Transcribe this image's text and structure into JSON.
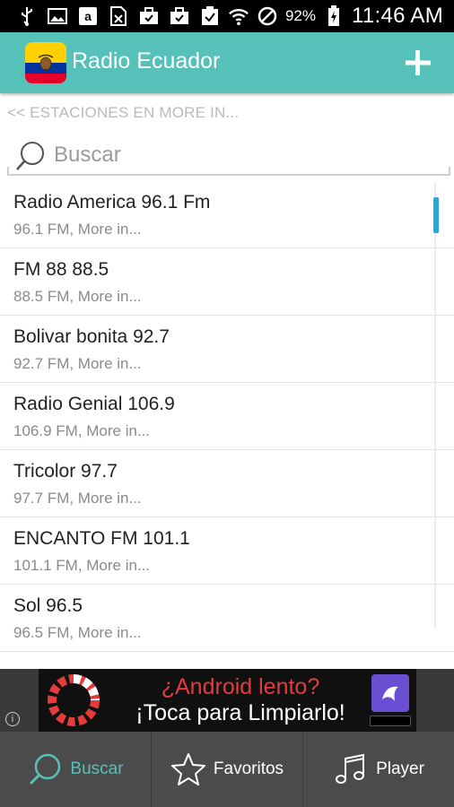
{
  "status_bar": {
    "battery": "92%",
    "time": "11:46 AM"
  },
  "app_bar": {
    "title": "Radio Ecuador",
    "add_label": "+"
  },
  "breadcrumb": "<< ESTACIONES EN MORE IN...",
  "search": {
    "placeholder": "Buscar",
    "value": ""
  },
  "stations": [
    {
      "name": "Radio America 96.1 Fm",
      "sub": "96.1 FM, More in..."
    },
    {
      "name": "FM 88 88.5",
      "sub": "88.5 FM, More in..."
    },
    {
      "name": "Bolivar bonita 92.7",
      "sub": "92.7 FM, More in..."
    },
    {
      "name": "Radio Genial 106.9",
      "sub": "106.9 FM, More in..."
    },
    {
      "name": "Tricolor 97.7",
      "sub": "97.7 FM, More in..."
    },
    {
      "name": "ENCANTO FM 101.1",
      "sub": "101.1 FM, More in..."
    },
    {
      "name": "Sol 96.5",
      "sub": "96.5 FM, More in..."
    }
  ],
  "ad": {
    "line1": "¿Android lento?",
    "line2": "¡Toca para Limpiarlo!",
    "info": "i"
  },
  "bottom_nav": [
    {
      "label": "Buscar",
      "icon": "search-icon",
      "active": true
    },
    {
      "label": "Favoritos",
      "icon": "star-icon",
      "active": false
    },
    {
      "label": "Player",
      "icon": "music-note-icon",
      "active": false
    }
  ],
  "colors": {
    "accent": "#55c1b8",
    "scroll_thumb": "#2aa6df",
    "nav_bg": "#4b4b4b"
  }
}
